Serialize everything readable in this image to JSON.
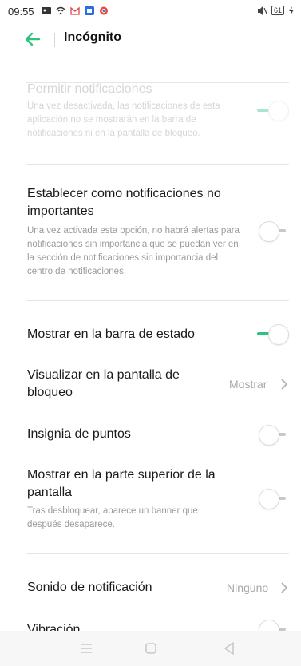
{
  "status_bar": {
    "time": "09:55",
    "battery": "61"
  },
  "header": {
    "title": "Incógnito",
    "accent": "#2ec27e"
  },
  "settings": {
    "allow_notifications": {
      "title": "Permitir notificaciones",
      "desc": "Una vez desactivada, las notificaciones de esta aplicación no se mostrarán en la barra de notificaciones ni en la pantalla de bloqueo.",
      "on": true,
      "enabled": false
    },
    "not_important": {
      "title": "Establecer como notificaciones no importantes",
      "desc": "Una vez activada esta opción, no habrá alertas para notificaciones sin importancia que se puedan ver en la sección de notificaciones sin importancia del centro de notificaciones.",
      "on": false
    },
    "status_bar_show": {
      "title": "Mostrar en la barra de estado",
      "on": true
    },
    "lock_screen": {
      "title": "Visualizar en la pantalla de bloqueo",
      "value": "Mostrar"
    },
    "dot_badge": {
      "title": "Insignia de puntos",
      "on": false
    },
    "top_of_screen": {
      "title": "Mostrar en la parte superior de la pantalla",
      "desc": "Tras desbloquear, aparece un banner que después desaparece.",
      "on": false
    },
    "sound": {
      "title": "Sonido de notificación",
      "value": "Ninguno"
    },
    "vibration": {
      "title": "Vibración",
      "on": false
    }
  }
}
